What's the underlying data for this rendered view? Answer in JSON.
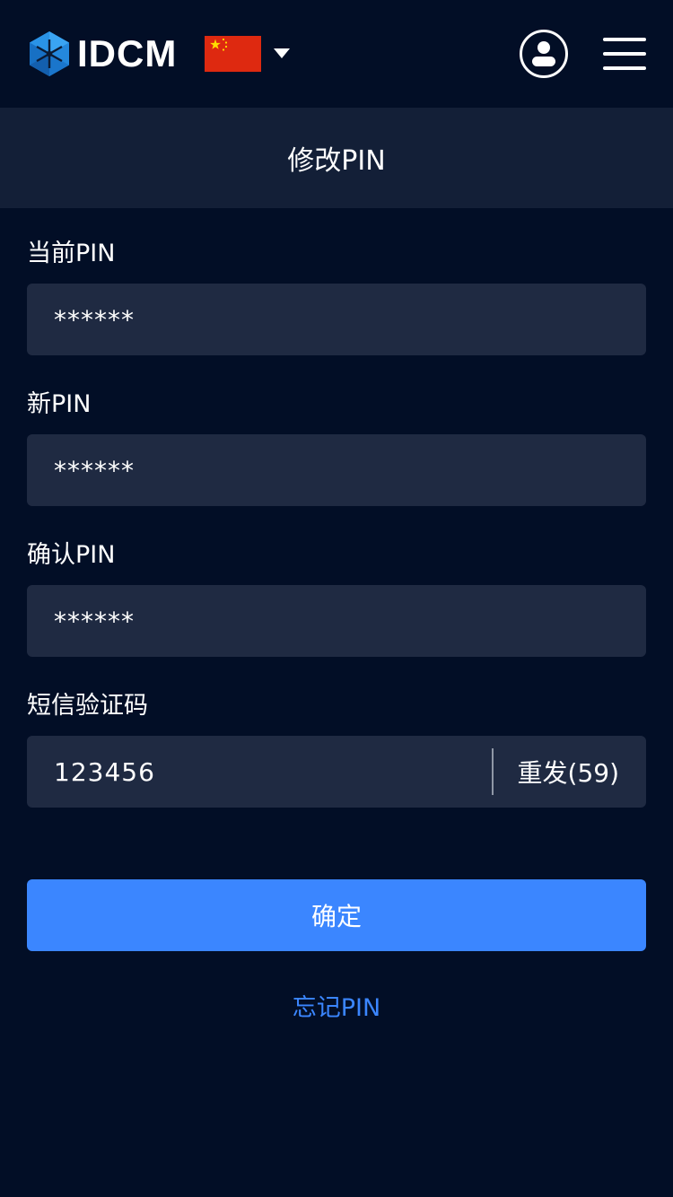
{
  "header": {
    "logo_text": "IDCM",
    "logo_icon": "idcm-hexagon-logo",
    "language_flag": "china-flag",
    "user_icon": "user-circle-icon",
    "menu_icon": "hamburger-menu-icon"
  },
  "page": {
    "title": "修改PIN"
  },
  "form": {
    "current_pin": {
      "label": "当前PIN",
      "value": "******"
    },
    "new_pin": {
      "label": "新PIN",
      "value": "******"
    },
    "confirm_pin": {
      "label": "确认PIN",
      "value": "******"
    },
    "sms_code": {
      "label": "短信验证码",
      "value": "123456",
      "resend_label": "重发(59)"
    },
    "submit_label": "确定",
    "forgot_label": "忘记PIN"
  },
  "colors": {
    "background": "#020e26",
    "title_bar": "#131f37",
    "input_bg": "#1f2a42",
    "accent": "#3b86ff",
    "flag_red": "#de2910",
    "flag_yellow": "#ffde00"
  }
}
